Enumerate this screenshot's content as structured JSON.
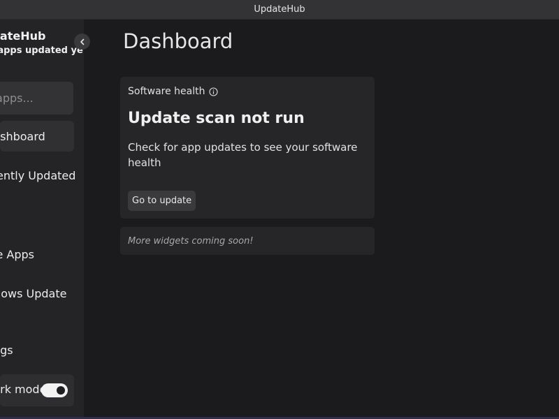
{
  "window": {
    "title": "UpdateHub"
  },
  "sidebar": {
    "app_title": "UpdateHub",
    "subtitle": "No apps updated yet!",
    "collapse_icon": "chevron-left-icon",
    "search": {
      "placeholder": "Search apps..."
    },
    "items": [
      {
        "label": "Dashboard",
        "active": true
      },
      {
        "label": "Recently Updated",
        "active": false
      },
      {
        "label": "Store Apps",
        "active": false
      },
      {
        "label": "Windows Update",
        "active": false
      },
      {
        "label": "Settings",
        "active": false
      }
    ],
    "dark_mode": {
      "label": "Dark mode",
      "on": true
    }
  },
  "main": {
    "title": "Dashboard",
    "health_card": {
      "header": "Software health",
      "header_icon": "info-icon",
      "heading": "Update scan not run",
      "text": "Check for app updates to see your software health",
      "button_label": "Go to update"
    },
    "more_widgets": "More widgets coming soon!"
  },
  "colors": {
    "background": "#1b1b1d",
    "sidebar": "#242426",
    "card": "#262628",
    "titlebar": "#333335"
  }
}
